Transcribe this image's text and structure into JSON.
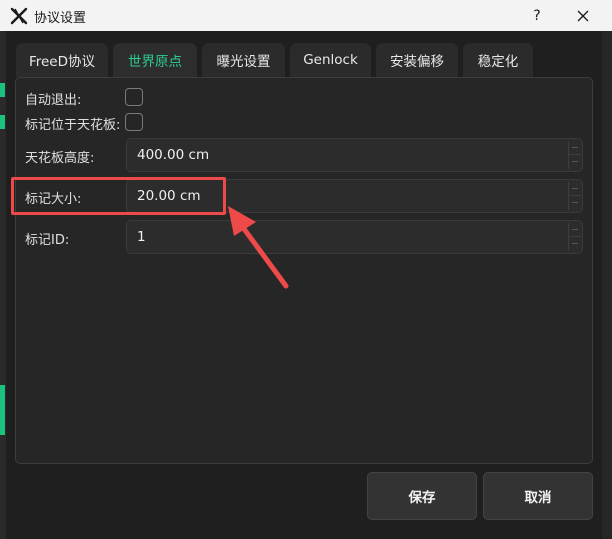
{
  "window": {
    "title": "协议设置",
    "help_label": "?"
  },
  "tabs": [
    {
      "label": "FreeD协议",
      "active": false
    },
    {
      "label": "世界原点",
      "active": true
    },
    {
      "label": "曝光设置",
      "active": false
    },
    {
      "label": "Genlock",
      "active": false
    },
    {
      "label": "安装偏移",
      "active": false
    },
    {
      "label": "稳定化",
      "active": false
    }
  ],
  "form": {
    "auto_exit": {
      "label": "自动退出:",
      "checked": false
    },
    "marker_on_ceiling": {
      "label": "标记位于天花板:",
      "checked": false
    },
    "ceiling_height": {
      "label": "天花板高度:",
      "value": "400.00 cm"
    },
    "marker_size": {
      "label": "标记大小:",
      "value": "20.00 cm"
    },
    "marker_id": {
      "label": "标记ID:",
      "value": "1"
    }
  },
  "buttons": {
    "save": "保存",
    "cancel": "取消"
  },
  "colors": {
    "accent": "#2ecf8f",
    "annotation": "#ef4a4a",
    "background": "#1f1f1f"
  },
  "icons": {
    "app": "app-logo-icon",
    "help": "help-icon",
    "close": "close-icon"
  }
}
